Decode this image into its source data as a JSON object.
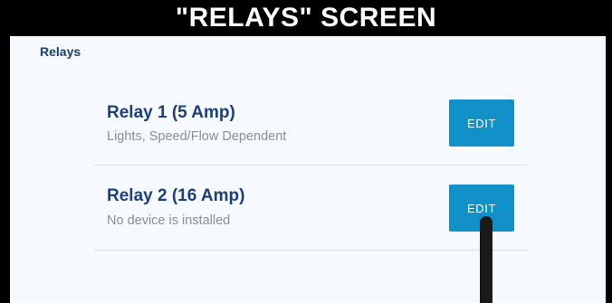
{
  "header": {
    "title": "\"RELAYS\" SCREEN"
  },
  "screen": {
    "breadcrumb": "Relays",
    "relays": [
      {
        "name": "Relay 1 (5 Amp)",
        "description": "Lights, Speed/Flow Dependent",
        "button_label": "EDIT"
      },
      {
        "name": "Relay 2 (16 Amp)",
        "description": "No device is installed",
        "button_label": "EDIT"
      }
    ]
  },
  "colors": {
    "accent": "#1291c9",
    "heading": "#1c3f78",
    "muted_text": "#8a8f96",
    "background": "#f6f9fe"
  }
}
